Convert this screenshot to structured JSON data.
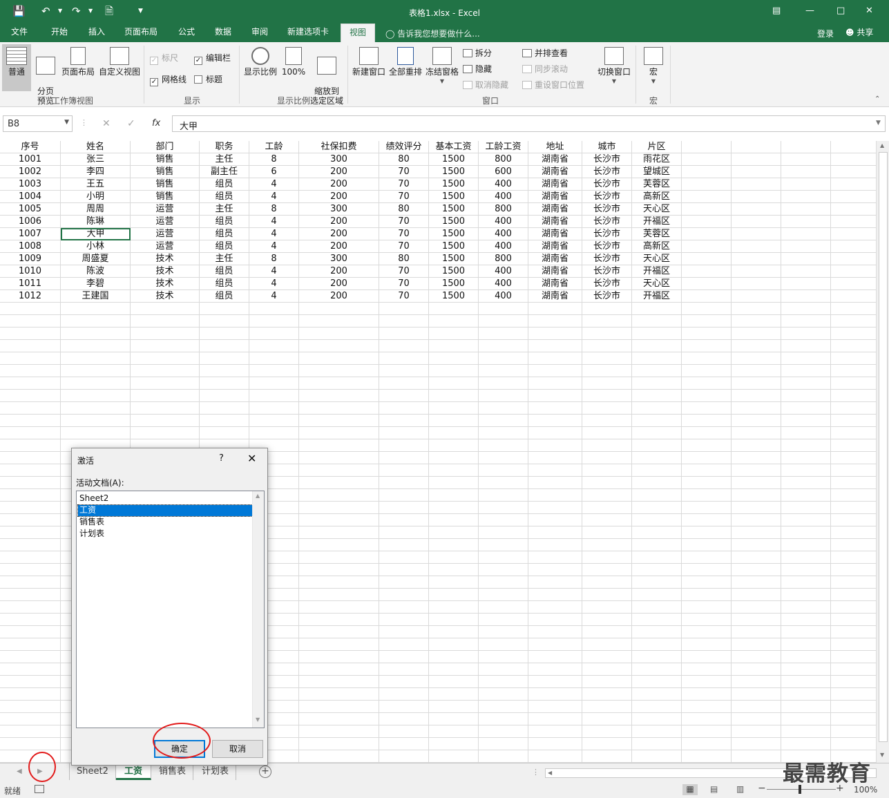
{
  "window": {
    "title": "表格1.xlsx - Excel"
  },
  "ribbon_tabs": [
    "文件",
    "开始",
    "插入",
    "页面布局",
    "公式",
    "数据",
    "审阅",
    "新建选项卡",
    "视图"
  ],
  "active_tab": "视图",
  "tell_me": "告诉我您想要做什么...",
  "account": {
    "login": "登录",
    "share": "共享"
  },
  "ribbon": {
    "workbook_views": {
      "label": "工作簿视图",
      "normal": "普通",
      "page_break": "分页\n预览",
      "page_layout": "页面布局",
      "custom": "自定义视图"
    },
    "show": {
      "label": "显示",
      "ruler": "标尺",
      "formula_bar": "编辑栏",
      "gridlines": "网格线",
      "headings": "标题"
    },
    "zoom": {
      "label": "显示比例",
      "zoom": "显示比例",
      "hundred": "100%",
      "to_selection": "缩放到\n选定区域"
    },
    "window": {
      "label": "窗口",
      "new_window": "新建窗口",
      "arrange_all": "全部重排",
      "freeze": "冻结窗格",
      "split": "拆分",
      "hide": "隐藏",
      "unhide": "取消隐藏",
      "side_by_side": "并排查看",
      "sync_scroll": "同步滚动",
      "reset_position": "重设窗口位置",
      "switch_windows": "切换窗口"
    },
    "macros": {
      "label": "宏",
      "macros": "宏"
    }
  },
  "formula_bar": {
    "name_box": "B8",
    "value": "大甲"
  },
  "sheet": {
    "headers": [
      "序号",
      "姓名",
      "部门",
      "职务",
      "工龄",
      "社保扣费",
      "绩效评分",
      "基本工资",
      "工龄工资",
      "地址",
      "城市",
      "片区"
    ],
    "rows": [
      [
        "1001",
        "张三",
        "销售",
        "主任",
        "8",
        "300",
        "80",
        "1500",
        "800",
        "湖南省",
        "长沙市",
        "雨花区"
      ],
      [
        "1002",
        "李四",
        "销售",
        "副主任",
        "6",
        "200",
        "70",
        "1500",
        "600",
        "湖南省",
        "长沙市",
        "望城区"
      ],
      [
        "1003",
        "王五",
        "销售",
        "组员",
        "4",
        "200",
        "70",
        "1500",
        "400",
        "湖南省",
        "长沙市",
        "芙蓉区"
      ],
      [
        "1004",
        "小明",
        "销售",
        "组员",
        "4",
        "200",
        "70",
        "1500",
        "400",
        "湖南省",
        "长沙市",
        "高新区"
      ],
      [
        "1005",
        "周周",
        "运营",
        "主任",
        "8",
        "300",
        "80",
        "1500",
        "800",
        "湖南省",
        "长沙市",
        "天心区"
      ],
      [
        "1006",
        "陈琳",
        "运营",
        "组员",
        "4",
        "200",
        "70",
        "1500",
        "400",
        "湖南省",
        "长沙市",
        "开福区"
      ],
      [
        "1007",
        "大甲",
        "运营",
        "组员",
        "4",
        "200",
        "70",
        "1500",
        "400",
        "湖南省",
        "长沙市",
        "芙蓉区"
      ],
      [
        "1008",
        "小林",
        "运营",
        "组员",
        "4",
        "200",
        "70",
        "1500",
        "400",
        "湖南省",
        "长沙市",
        "高新区"
      ],
      [
        "1009",
        "周盛夏",
        "技术",
        "主任",
        "8",
        "300",
        "80",
        "1500",
        "800",
        "湖南省",
        "长沙市",
        "天心区"
      ],
      [
        "1010",
        "陈波",
        "技术",
        "组员",
        "4",
        "200",
        "70",
        "1500",
        "400",
        "湖南省",
        "长沙市",
        "开福区"
      ],
      [
        "1011",
        "李碧",
        "技术",
        "组员",
        "4",
        "200",
        "70",
        "1500",
        "400",
        "湖南省",
        "长沙市",
        "天心区"
      ],
      [
        "1012",
        "王建国",
        "技术",
        "组员",
        "4",
        "200",
        "70",
        "1500",
        "400",
        "湖南省",
        "长沙市",
        "开福区"
      ]
    ],
    "selected": {
      "row": 6,
      "col": 1
    }
  },
  "dialog": {
    "title": "激活",
    "help": "?",
    "close": "✕",
    "label": "活动文档(A):",
    "items": [
      "Sheet2",
      "工资",
      "销售表",
      "计划表"
    ],
    "selected_index": 1,
    "ok": "确定",
    "cancel": "取消"
  },
  "sheet_tabs": [
    "Sheet2",
    "工资",
    "销售表",
    "计划表"
  ],
  "active_sheet": "工资",
  "status": {
    "ready": "就绪",
    "zoom": "100%"
  },
  "watermark": "最需教育",
  "colors": {
    "brand": "#217346",
    "selection": "#0078d7",
    "annotation": "#e21b1b"
  }
}
